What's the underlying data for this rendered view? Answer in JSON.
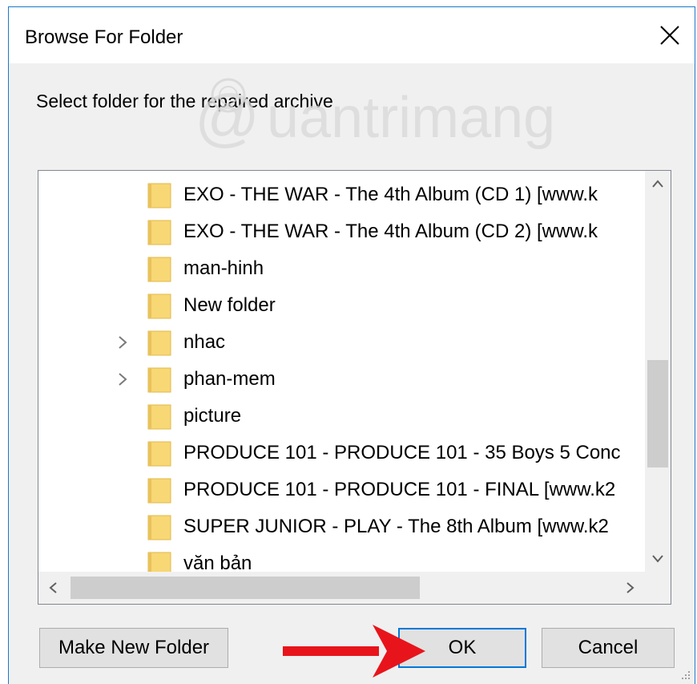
{
  "dialog": {
    "title": "Browse For Folder",
    "prompt": "Select folder for the repaired archive"
  },
  "watermark": {
    "text": "uantrimang"
  },
  "tree": {
    "items": [
      {
        "label": "EXO - THE WAR - The 4th Album (CD 1) [www.k",
        "expandable": false
      },
      {
        "label": "EXO - THE WAR - The 4th Album (CD 2) [www.k",
        "expandable": false
      },
      {
        "label": "man-hinh",
        "expandable": false
      },
      {
        "label": "New folder",
        "expandable": false
      },
      {
        "label": "nhac",
        "expandable": true
      },
      {
        "label": "phan-mem",
        "expandable": true
      },
      {
        "label": "picture",
        "expandable": false
      },
      {
        "label": "PRODUCE 101 - PRODUCE 101 - 35 Boys 5 Conc",
        "expandable": false
      },
      {
        "label": "PRODUCE 101 - PRODUCE 101 - FINAL [www.k2",
        "expandable": false
      },
      {
        "label": "SUPER JUNIOR - PLAY - The 8th Album [www.k2",
        "expandable": false
      },
      {
        "label": "văn bản",
        "expandable": false
      }
    ],
    "vertical_scroll_position": 0.55,
    "horizontal_scroll_position": 0.0
  },
  "buttons": {
    "make_new_folder": "Make New Folder",
    "ok": "OK",
    "cancel": "Cancel"
  },
  "colors": {
    "accent": "#0078d7",
    "folder": "#f8d775",
    "arrow": "#e8141b"
  }
}
